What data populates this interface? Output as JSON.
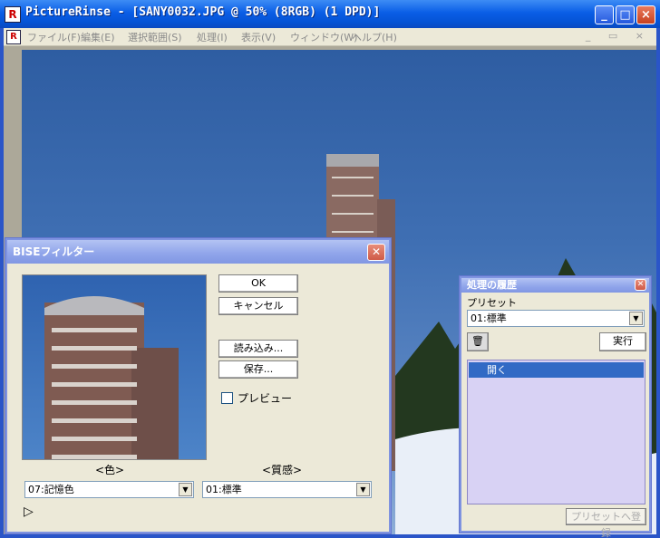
{
  "window": {
    "title": "PictureRinse - [SANY0032.JPG @ 50% (8RGB) (1 DPD)]",
    "app_icon_text": "R",
    "controls": {
      "minimize": "_",
      "maximize": "□",
      "close": "×"
    }
  },
  "menubar": {
    "items": [
      "ファイル(F)",
      "編集(E)",
      "選択範囲(S)",
      "処理(I)",
      "表示(V)",
      "ウィンドウ(W)",
      "ヘルプ(H)"
    ],
    "mdi_controls": "_ ▭ ×"
  },
  "bise_dialog": {
    "title": "BISEフィルター",
    "ok": "OK",
    "cancel": "キャンセル",
    "load": "読み込み...",
    "save": "保存...",
    "preview_label": "プレビュー",
    "preview_checked": false,
    "color_label": "<色>",
    "texture_label": "<質感>",
    "color_value": "07:記憶色",
    "texture_value": "01:標準",
    "play_icon": "▷"
  },
  "history_panel": {
    "title": "処理の履歴",
    "preset_label": "プリセット",
    "preset_value": "01:標準",
    "execute": "実行",
    "items": [
      "開く"
    ],
    "register": "プリセットへ登録"
  }
}
